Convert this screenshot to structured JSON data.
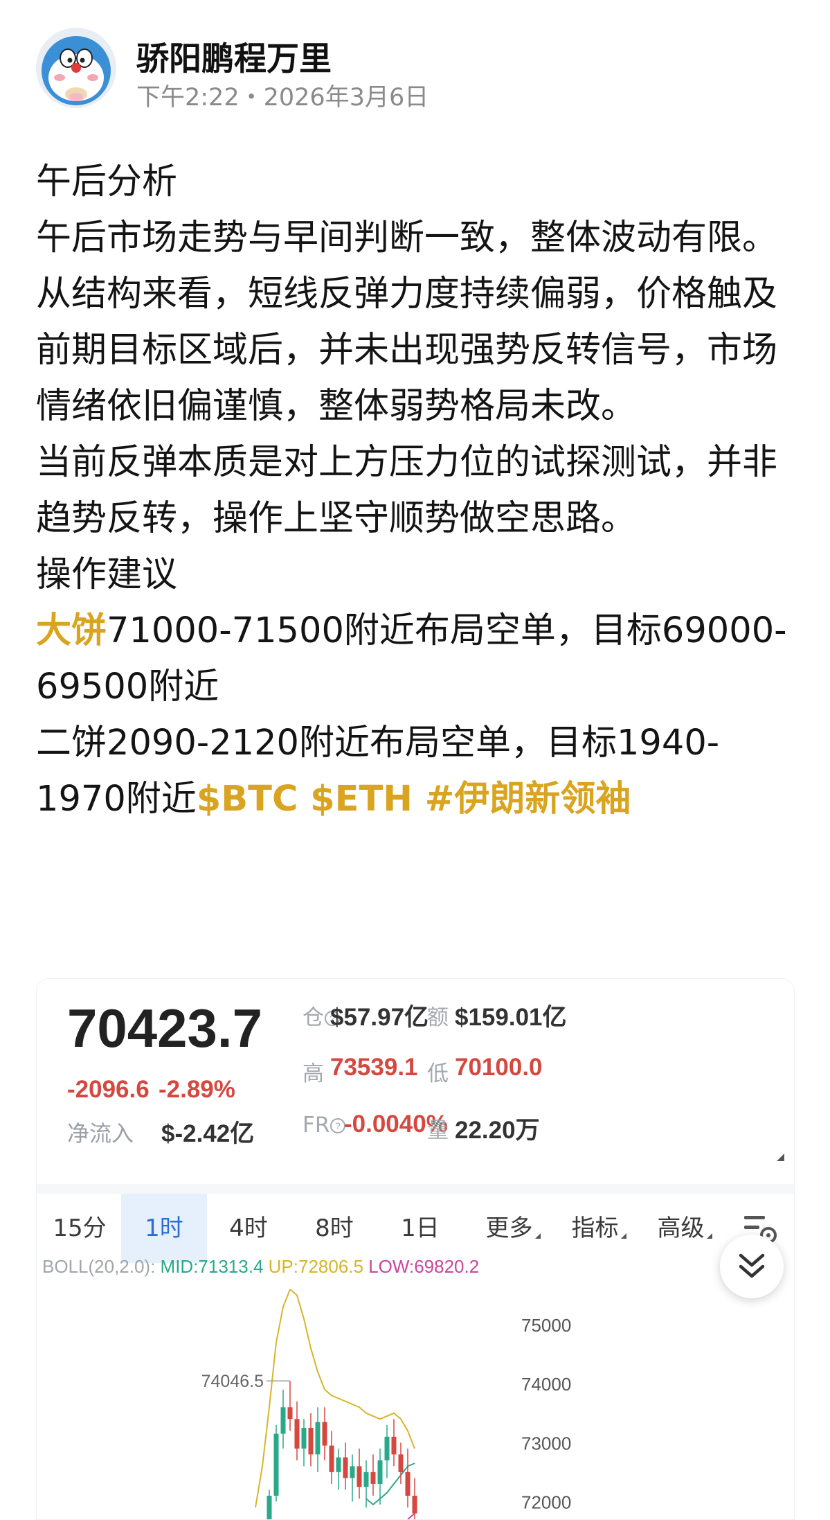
{
  "post": {
    "author": "骄阳鹏程万里",
    "time": "下午2:22",
    "separator": "・",
    "date": "2026年3月6日",
    "lines": {
      "l1": "午后分析",
      "l2": "午后市场走势与早间判断一致，整体波动有限。",
      "l3": "从结构来看，短线反弹力度持续偏弱，价格触及前期目标区域后，并未出现强势反转信号，市场情绪依旧偏谨慎，整体弱势格局未改。",
      "l4": "当前反弹本质是对上方压力位的试探测试，并非趋势反转，操作上坚守顺势做空思路。",
      "l5": "操作建议",
      "l6_hl": "大饼",
      "l6": "71000-71500附近布局空单，目标69000-69500附近",
      "l7": "二饼2090-2120附近布局空单，目标1940-1970附近",
      "tags": "$BTC $ETH #伊朗新领袖"
    }
  },
  "ticker": {
    "price": "70423.7",
    "change": "-2096.6",
    "change_pct": "-2.89%",
    "netflow_label": "净流入",
    "netflow_value": "$-2.42亿",
    "oi_label": "仓",
    "oi_value": "$57.97亿",
    "vol_amt_label": "额",
    "vol_amt_value": "$159.01亿",
    "high_label": "高",
    "high_value": "73539.1",
    "low_label": "低",
    "low_value": "70100.0",
    "fr_label": "FR",
    "fr_value": "-0.0040%",
    "qty_label": "量",
    "qty_value": "22.20万"
  },
  "tabs": [
    "15分",
    "1时",
    "4时",
    "8时",
    "1日",
    "更多",
    "指标",
    "高级"
  ],
  "active_tab": "1时",
  "boll": {
    "title": "BOLL(20,2.0):",
    "mid": "MID:71313.4",
    "up": "UP:72806.5",
    "low": "LOW:69820.2"
  },
  "colors": {
    "highlight": "#d9a41f",
    "down": "#d5473f",
    "up": "#2aa88a",
    "boll_mid": "#2aa88a",
    "boll_up": "#d6b52a",
    "boll_low": "#c9469a",
    "active_tab": "#2b6cd6"
  },
  "icons": {
    "avatar": "cartoon-cat-avatar",
    "collapse": "double-chevron-down-icon",
    "settings": "chart-settings-icon",
    "info": "info-circle-icon"
  },
  "chart_data": {
    "type": "candlestick",
    "y_ticks": [
      "75000",
      "74000",
      "73000",
      "72000"
    ],
    "yrange": [
      71700,
      75600
    ],
    "max_label": "74046.5",
    "max_value": 74046.5,
    "candles": [
      {
        "o": 71450,
        "h": 71620,
        "l": 71380,
        "c": 71560
      },
      {
        "o": 71560,
        "h": 72200,
        "l": 71500,
        "c": 72100
      },
      {
        "o": 72100,
        "h": 73300,
        "l": 72000,
        "c": 73150
      },
      {
        "o": 73150,
        "h": 73900,
        "l": 72900,
        "c": 73600
      },
      {
        "o": 73600,
        "h": 74046.5,
        "l": 73200,
        "c": 73400
      },
      {
        "o": 73400,
        "h": 73700,
        "l": 72700,
        "c": 72900
      },
      {
        "o": 72900,
        "h": 73400,
        "l": 72600,
        "c": 73250
      },
      {
        "o": 73250,
        "h": 73500,
        "l": 72600,
        "c": 72800
      },
      {
        "o": 72800,
        "h": 73600,
        "l": 72500,
        "c": 73350
      },
      {
        "o": 73350,
        "h": 73600,
        "l": 72700,
        "c": 72950
      },
      {
        "o": 72950,
        "h": 73200,
        "l": 72300,
        "c": 72500
      },
      {
        "o": 72500,
        "h": 72900,
        "l": 72200,
        "c": 72750
      },
      {
        "o": 72750,
        "h": 73000,
        "l": 72200,
        "c": 72400
      },
      {
        "o": 72400,
        "h": 72800,
        "l": 72000,
        "c": 72600
      },
      {
        "o": 72600,
        "h": 72900,
        "l": 72050,
        "c": 72250
      },
      {
        "o": 72250,
        "h": 72700,
        "l": 71900,
        "c": 72500
      },
      {
        "o": 72500,
        "h": 72800,
        "l": 72100,
        "c": 72300
      },
      {
        "o": 72300,
        "h": 72900,
        "l": 71950,
        "c": 72700
      },
      {
        "o": 72700,
        "h": 73300,
        "l": 72400,
        "c": 73100
      },
      {
        "o": 73100,
        "h": 73400,
        "l": 72600,
        "c": 72800
      },
      {
        "o": 72800,
        "h": 73000,
        "l": 72300,
        "c": 72500
      },
      {
        "o": 72500,
        "h": 72900,
        "l": 71900,
        "c": 72100
      },
      {
        "o": 72100,
        "h": 72400,
        "l": 71700,
        "c": 71800
      }
    ],
    "boll_upper": [
      71900,
      72600,
      73600,
      74700,
      75300,
      75600,
      75500,
      75100,
      74600,
      74200,
      73900,
      73800,
      73750,
      73700,
      73650,
      73600,
      73500,
      73450,
      73400,
      73450,
      73500,
      73400,
      73200,
      72900
    ],
    "boll_mid": [
      72050,
      71950,
      72050,
      72150,
      72300,
      72450,
      72600,
      72650
    ],
    "boll_lower": [
      71700,
      71800
    ]
  }
}
